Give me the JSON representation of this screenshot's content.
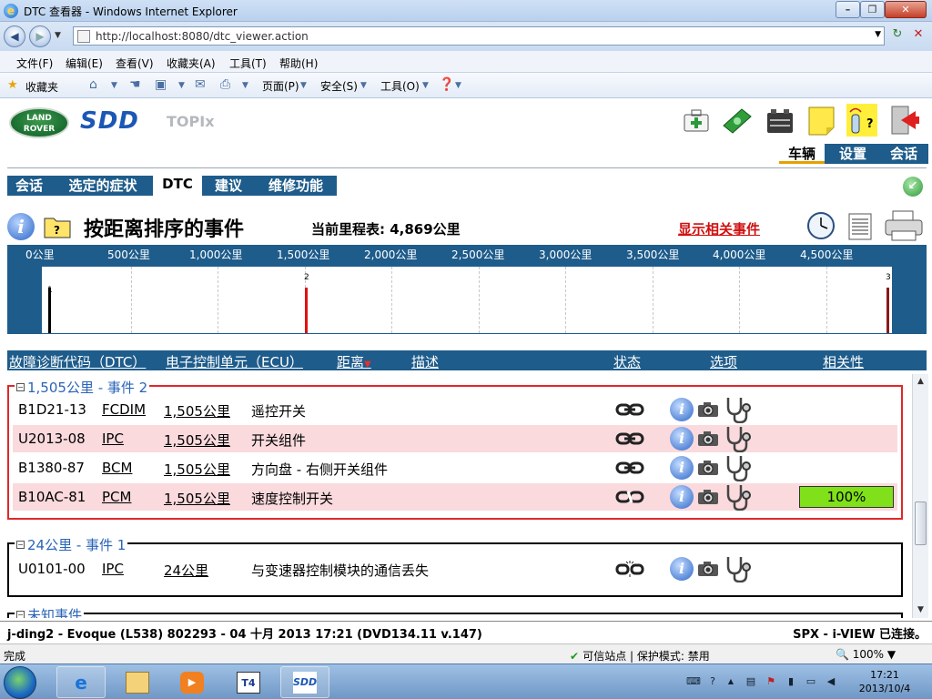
{
  "window": {
    "title": "DTC 查看器 - Windows Internet Explorer",
    "url": "http://localhost:8080/dtc_viewer.action"
  },
  "menu": [
    "文件(F)",
    "编辑(E)",
    "查看(V)",
    "收藏夹(A)",
    "工具(T)",
    "帮助(H)"
  ],
  "favbar": {
    "favorites_label": "收藏夹",
    "page_label": "页面(P)",
    "safety_label": "安全(S)",
    "tools_label": "工具(O)"
  },
  "app": {
    "brand": {
      "land_rover": "LAND ROVER",
      "sdd": "SDD",
      "topix": "TOPIx"
    },
    "topnav": [
      "车辆",
      "设置",
      "会话"
    ],
    "topnav_active": "车辆",
    "subtabs": [
      "会话",
      "选定的症状",
      "DTC",
      "建议",
      "维修功能"
    ],
    "subtab_active": "DTC",
    "page_title": "按距离排序的事件",
    "odometer": "当前里程表: 4,869公里",
    "show_related_link": "显示相关事件"
  },
  "timeline": {
    "ticks": [
      "0公里",
      "500公里",
      "1,000公里",
      "1,500公里",
      "2,000公里",
      "2,500公里",
      "3,000公里",
      "3,500公里",
      "4,000公里",
      "4,500公里"
    ],
    "markers": [
      {
        "label": "1",
        "km": 24,
        "color": "#000000"
      },
      {
        "label": "2",
        "km": 1505,
        "color": "#e01010"
      },
      {
        "label": "3",
        "km": 4869,
        "color": "#8b1a1a"
      }
    ]
  },
  "table": {
    "headers": {
      "dtc": "故障诊断代码（DTC）",
      "ecu": "电子控制单元（ECU）",
      "distance": "距离",
      "description": "描述",
      "status": "状态",
      "options": "选项",
      "relevance": "相关性"
    },
    "groups": [
      {
        "label": "1,505公里 - 事件 2",
        "border_color": "#e0282a",
        "rows": [
          {
            "dtc": "B1D21-13",
            "ecu": "FCDIM",
            "distance": "1,505公里",
            "description": "遥控开关",
            "status_icon": "link-chain-icon",
            "relevance": ""
          },
          {
            "dtc": "U2013-08",
            "ecu": "IPC",
            "distance": "1,505公里",
            "description": "开关组件",
            "status_icon": "link-chain-icon",
            "relevance": ""
          },
          {
            "dtc": "B1380-87",
            "ecu": "BCM",
            "distance": "1,505公里",
            "description": "方向盘 - 右侧开关组件",
            "status_icon": "link-chain-icon",
            "relevance": ""
          },
          {
            "dtc": "B10AC-81",
            "ecu": "PCM",
            "distance": "1,505公里",
            "description": "速度控制开关",
            "status_icon": "link-half-icon",
            "relevance": "100%"
          }
        ]
      },
      {
        "label": "24公里 - 事件 1",
        "border_color": "#000000",
        "rows": [
          {
            "dtc": "U0101-00",
            "ecu": "IPC",
            "distance": "24公里",
            "description": "与变速器控制模块的通信丢失",
            "status_icon": "broken-link-icon",
            "relevance": ""
          }
        ]
      },
      {
        "label": "未知事件",
        "border_color": "#000000",
        "rows": []
      }
    ]
  },
  "status_strip": {
    "vehicle_info": "j-ding2 - Evoque (L538) 802293 - 04 十月 2013 17:21 (DVD134.11 v.147)",
    "connection": "SPX - i-VIEW 已连接。"
  },
  "ie_status": {
    "done": "完成",
    "zone": "可信站点 | 保护模式: 禁用",
    "zoom": "100%"
  },
  "taskbar": {
    "time": "17:21",
    "date": "2013/10/4",
    "tasks": [
      "ie-icon",
      "explorer-icon",
      "media-player-icon",
      "t4-icon",
      "sdd-icon"
    ],
    "t4_label": "T4",
    "sdd_label": "SDD"
  }
}
